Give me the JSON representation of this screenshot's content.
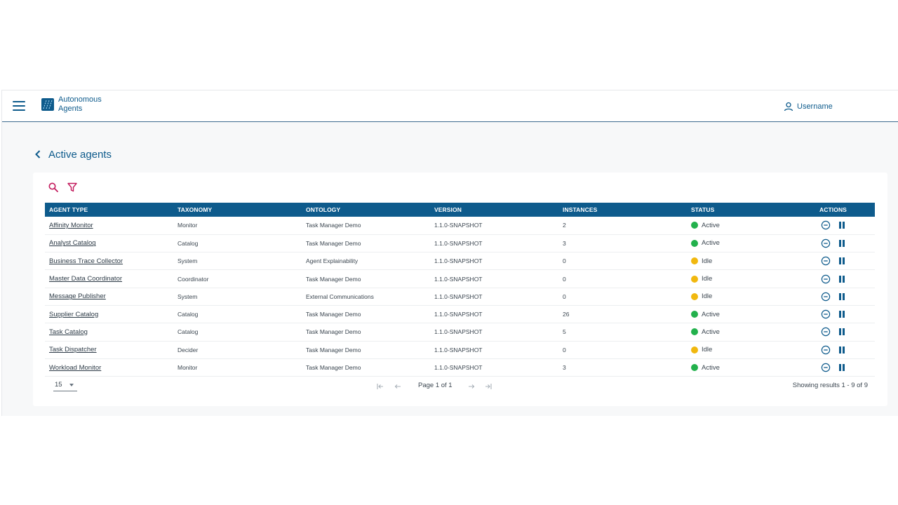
{
  "app": {
    "title": "Autonomous Agents",
    "user_label": "Username"
  },
  "page": {
    "title": "Active agents"
  },
  "colors": {
    "primary": "#0e5b8c",
    "accent": "#c2185b",
    "active": "#22b14c",
    "idle": "#f1b80f"
  },
  "toolbar": {
    "search_icon": "search-icon",
    "filter_icon": "filter-icon"
  },
  "table": {
    "columns": [
      "AGENT TYPE",
      "TAXONOMY",
      "ONTOLOGY",
      "VERSION",
      "INSTANCES",
      "STATUS",
      "ACTIONS"
    ],
    "rows": [
      {
        "agent_type": "Affinity Monitor",
        "taxonomy": "Monitor",
        "ontology": "Task Manager Demo",
        "version": "1.1.0-SNAPSHOT",
        "instances": "2",
        "status": "Active"
      },
      {
        "agent_type": "Analyst Catalog",
        "taxonomy": "Catalog",
        "ontology": "Task Manager Demo",
        "version": "1.1.0-SNAPSHOT",
        "instances": "3",
        "status": "Active"
      },
      {
        "agent_type": "Business Trace Collector",
        "taxonomy": "System",
        "ontology": "Agent Explainability",
        "version": "1.1.0-SNAPSHOT",
        "instances": "0",
        "status": "Idle"
      },
      {
        "agent_type": "Master Data Coordinator",
        "taxonomy": "Coordinator",
        "ontology": "Task Manager Demo",
        "version": "1.1.0-SNAPSHOT",
        "instances": "0",
        "status": "Idle"
      },
      {
        "agent_type": "Message Publisher",
        "taxonomy": "System",
        "ontology": "External Communications",
        "version": "1.1.0-SNAPSHOT",
        "instances": "0",
        "status": "Idle"
      },
      {
        "agent_type": "Supplier Catalog",
        "taxonomy": "Catalog",
        "ontology": "Task Manager Demo",
        "version": "1.1.0-SNAPSHOT",
        "instances": "26",
        "status": "Active"
      },
      {
        "agent_type": "Task Catalog",
        "taxonomy": "Catalog",
        "ontology": "Task Manager Demo",
        "version": "1.1.0-SNAPSHOT",
        "instances": "5",
        "status": "Active"
      },
      {
        "agent_type": "Task Dispatcher",
        "taxonomy": "Decider",
        "ontology": "Task Manager Demo",
        "version": "1.1.0-SNAPSHOT",
        "instances": "0",
        "status": "Idle"
      },
      {
        "agent_type": "Workload Monitor",
        "taxonomy": "Monitor",
        "ontology": "Task Manager Demo",
        "version": "1.1.0-SNAPSHOT",
        "instances": "3",
        "status": "Active"
      }
    ]
  },
  "pagination": {
    "page_size": "15",
    "page_label": "Page 1 of 1",
    "results_label": "Showing results 1 - 9 of 9"
  }
}
